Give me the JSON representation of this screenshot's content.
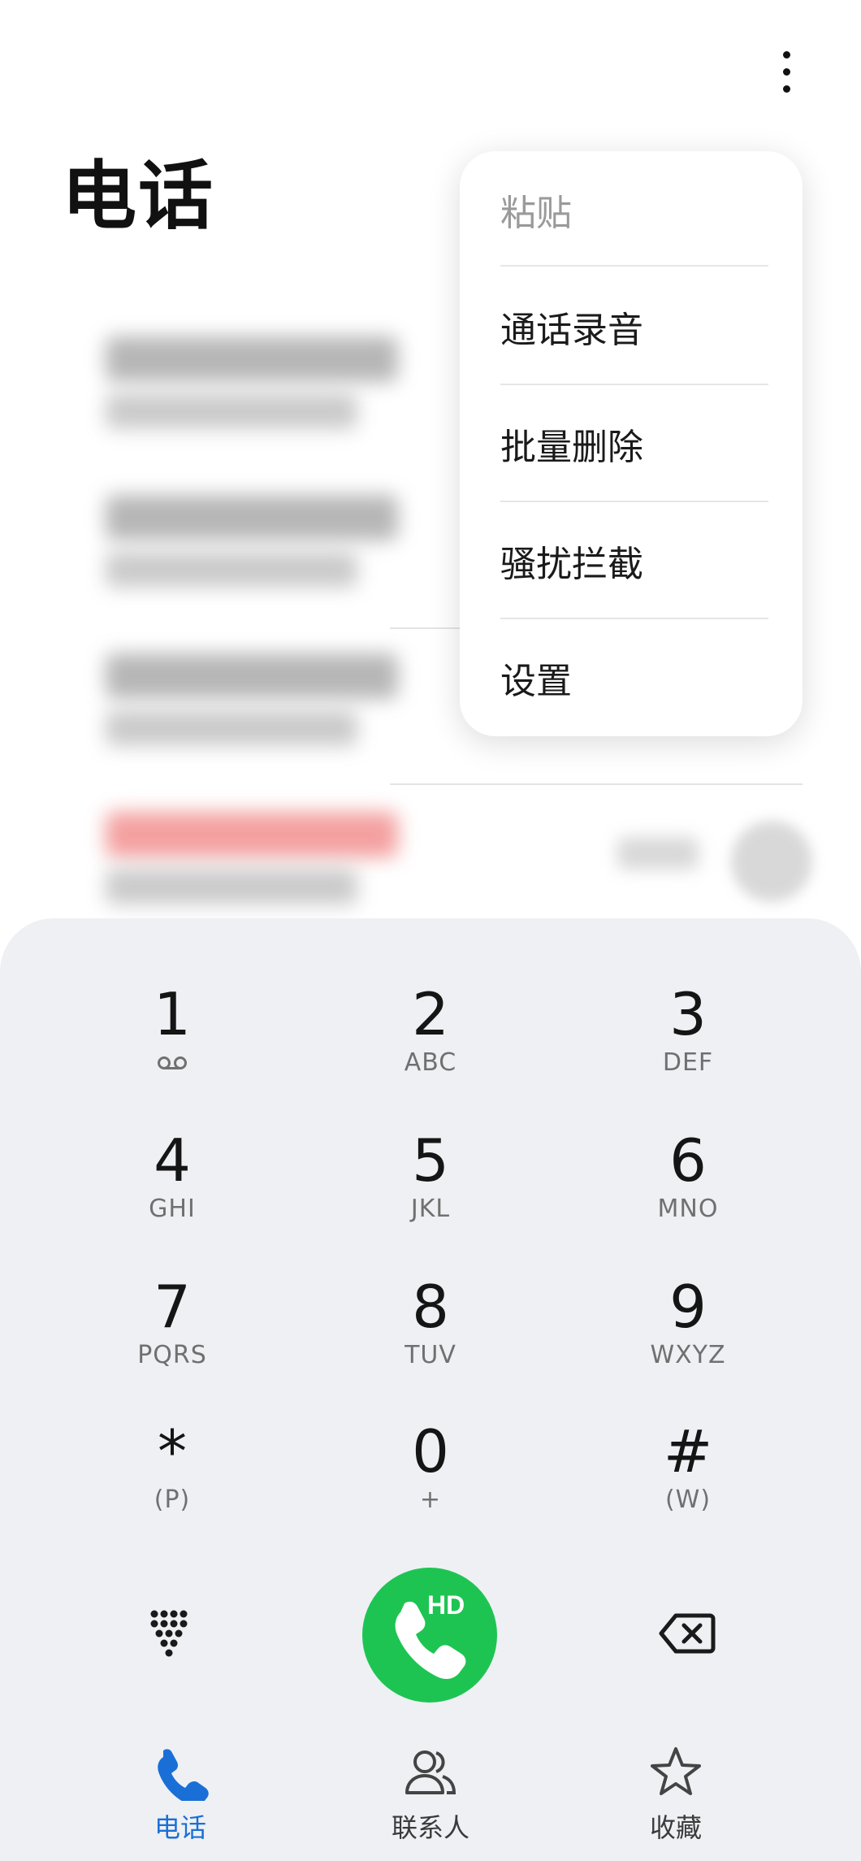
{
  "header": {
    "title": "电话",
    "more_icon": "more-vertical-icon"
  },
  "call_log": {
    "items": [
      {
        "name": "████████████",
        "detail": "██████ ██████",
        "missed": false
      },
      {
        "name": "████████████",
        "detail": "████████",
        "missed": false
      },
      {
        "name": "████████████",
        "detail": "██████████",
        "missed": false
      },
      {
        "name": "████████████",
        "detail": "██████████",
        "missed": true
      }
    ]
  },
  "popup_menu": {
    "items": [
      {
        "label": "粘贴",
        "enabled": false
      },
      {
        "label": "通话录音",
        "enabled": true
      },
      {
        "label": "批量删除",
        "enabled": true
      },
      {
        "label": "骚扰拦截",
        "enabled": true
      },
      {
        "label": "设置",
        "enabled": true
      }
    ]
  },
  "dialpad": {
    "keys": [
      {
        "digit": "1",
        "sub": "",
        "sub_icon": "voicemail-icon"
      },
      {
        "digit": "2",
        "sub": "ABC"
      },
      {
        "digit": "3",
        "sub": "DEF"
      },
      {
        "digit": "4",
        "sub": "GHI"
      },
      {
        "digit": "5",
        "sub": "JKL"
      },
      {
        "digit": "6",
        "sub": "MNO"
      },
      {
        "digit": "7",
        "sub": "PQRS"
      },
      {
        "digit": "8",
        "sub": "TUV"
      },
      {
        "digit": "9",
        "sub": "WXYZ"
      },
      {
        "digit": "*",
        "sub": "(P)"
      },
      {
        "digit": "0",
        "sub": "+"
      },
      {
        "digit": "#",
        "sub": "(W)"
      }
    ],
    "call_label": "HD",
    "toggle_icon": "dialpad-grid-icon",
    "backspace_icon": "backspace-icon",
    "call_color": "#1ec452"
  },
  "bottom_nav": {
    "tabs": [
      {
        "label": "电话",
        "icon": "phone-icon",
        "active": true
      },
      {
        "label": "联系人",
        "icon": "contacts-icon",
        "active": false
      },
      {
        "label": "收藏",
        "icon": "star-icon",
        "active": false
      }
    ],
    "active_color": "#1a6fd6"
  }
}
